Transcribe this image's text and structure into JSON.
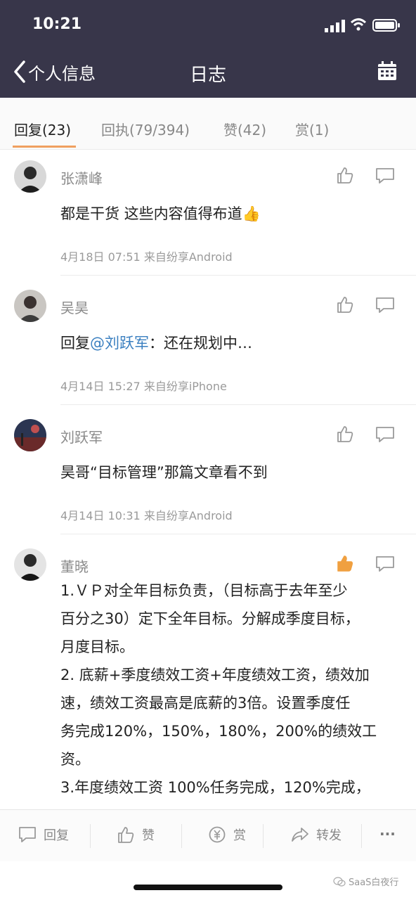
{
  "status_bar": {
    "time": "10:21"
  },
  "nav": {
    "back_label": "个人信息",
    "title": "日志"
  },
  "tabs": [
    {
      "label": "回复(23)"
    },
    {
      "label": "回执(79/394)"
    },
    {
      "label": "赞(42)"
    },
    {
      "label": "赏(1)"
    }
  ],
  "comments": [
    {
      "name": "张潇峰",
      "body": "都是干货 这些内容值得布道👍",
      "meta": "4月18日 07:51 来自纷享Android",
      "liked": false
    },
    {
      "name": "吴昊",
      "body_prefix": "回复",
      "mention": "@刘跃军",
      "body_suffix": "：还在规划中…",
      "meta": "4月14日 15:27 来自纷享iPhone",
      "liked": false
    },
    {
      "name": "刘跃军",
      "body": "昊哥“目标管理”那篇文章看不到",
      "meta": "4月14日 10:31 来自纷享Android",
      "liked": false
    },
    {
      "name": "董晓",
      "liked": true,
      "body_lines": [
        "1.ＶＰ对全年目标负责，（目标高于去年至少",
        "百分之30）定下全年目标。分解成季度目标，",
        "月度目标。",
        "2. 底薪+季度绩效工资+年度绩效工资，绩效加",
        "速，绩效工资最高是底薪的3倍。设置季度任",
        "务完成120%，150%，180%，200%的绩效工",
        "资。",
        "3.年度绩效工资 100%任务完成，120%完成，"
      ]
    }
  ],
  "bottom_bar": {
    "reply": "回复",
    "like": "赞",
    "reward": "赏",
    "forward": "转发",
    "more": "···"
  },
  "watermark": "SaaS白夜行",
  "colors": {
    "header_bg": "#38364a",
    "tab_underline": "#f0a060",
    "mention": "#3a7fc0",
    "liked": "#f0a040"
  }
}
